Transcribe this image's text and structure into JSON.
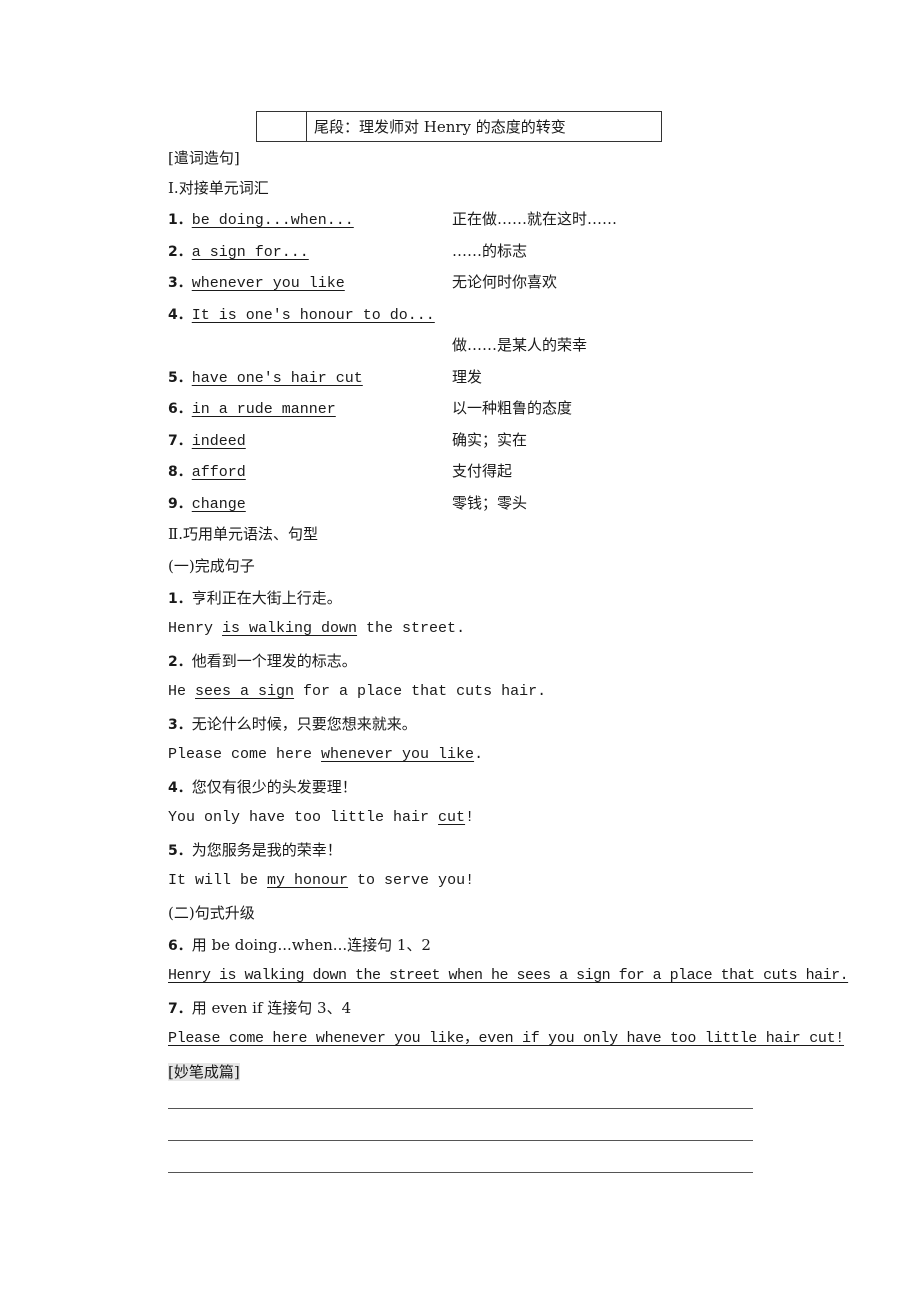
{
  "table": {
    "cell_right": "尾段：理发师对 Henry 的态度的转变"
  },
  "section_heading": "[遣词造句]",
  "part1": {
    "title": "Ⅰ.对接单元词汇",
    "items": [
      {
        "num": "1．",
        "en": "be doing...when...",
        "zh": "正在做……就在这时……"
      },
      {
        "num": "2．",
        "en": "a sign for...",
        "zh": "……的标志"
      },
      {
        "num": "3．",
        "en": "whenever you like",
        "zh": "无论何时你喜欢"
      },
      {
        "num": "4．",
        "en": "It is one's honour to do...",
        "zh": "做……是某人的荣幸"
      },
      {
        "num": "5．",
        "en": "have one's hair cut",
        "zh": "理发"
      },
      {
        "num": "6．",
        "en": "in a rude manner",
        "zh": "以一种粗鲁的态度"
      },
      {
        "num": "7．",
        "en": "indeed",
        "zh": "确实；实在"
      },
      {
        "num": "8．",
        "en": "afford",
        "zh": "支付得起"
      },
      {
        "num": "9．",
        "en": "change",
        "zh": "零钱；零头"
      }
    ]
  },
  "part2": {
    "title": "Ⅱ.巧用单元语法、句型",
    "sub1": {
      "title": "(一)完成句子",
      "items": [
        {
          "num": "1．",
          "zh": "亨利正在大街上行走。",
          "pre": "Henry ",
          "ans": "is walking down",
          "post": " the street."
        },
        {
          "num": "2．",
          "zh": "他看到一个理发的标志。",
          "pre": "He ",
          "ans": "sees a sign",
          "post": " for a place that cuts hair."
        },
        {
          "num": "3．",
          "zh": "无论什么时候，只要您想来就来。",
          "pre": "Please come here ",
          "ans": "whenever you like",
          "post": "."
        },
        {
          "num": "4．",
          "zh": "您仅有很少的头发要理！",
          "pre": "You only have too little hair ",
          "ans": "cut",
          "post": "!"
        },
        {
          "num": "5．",
          "zh": "为您服务是我的荣幸！",
          "pre": "It will be ",
          "ans": "my honour",
          "post": " to serve you!"
        }
      ]
    },
    "sub2": {
      "title": "(二)句式升级",
      "items": [
        {
          "num": "6．",
          "prompt": "用 be doing...when...连接句 1、2",
          "answer": "Henry is walking down the street when he sees a sign for a place that cuts hair."
        },
        {
          "num": "7．",
          "prompt": "用 even if 连接句 3、4",
          "answer": "Please come here whenever you like，even if you only have too little hair cut!"
        }
      ]
    }
  },
  "writing": {
    "title": "[妙笔成篇]",
    "blank_lines": 3
  }
}
